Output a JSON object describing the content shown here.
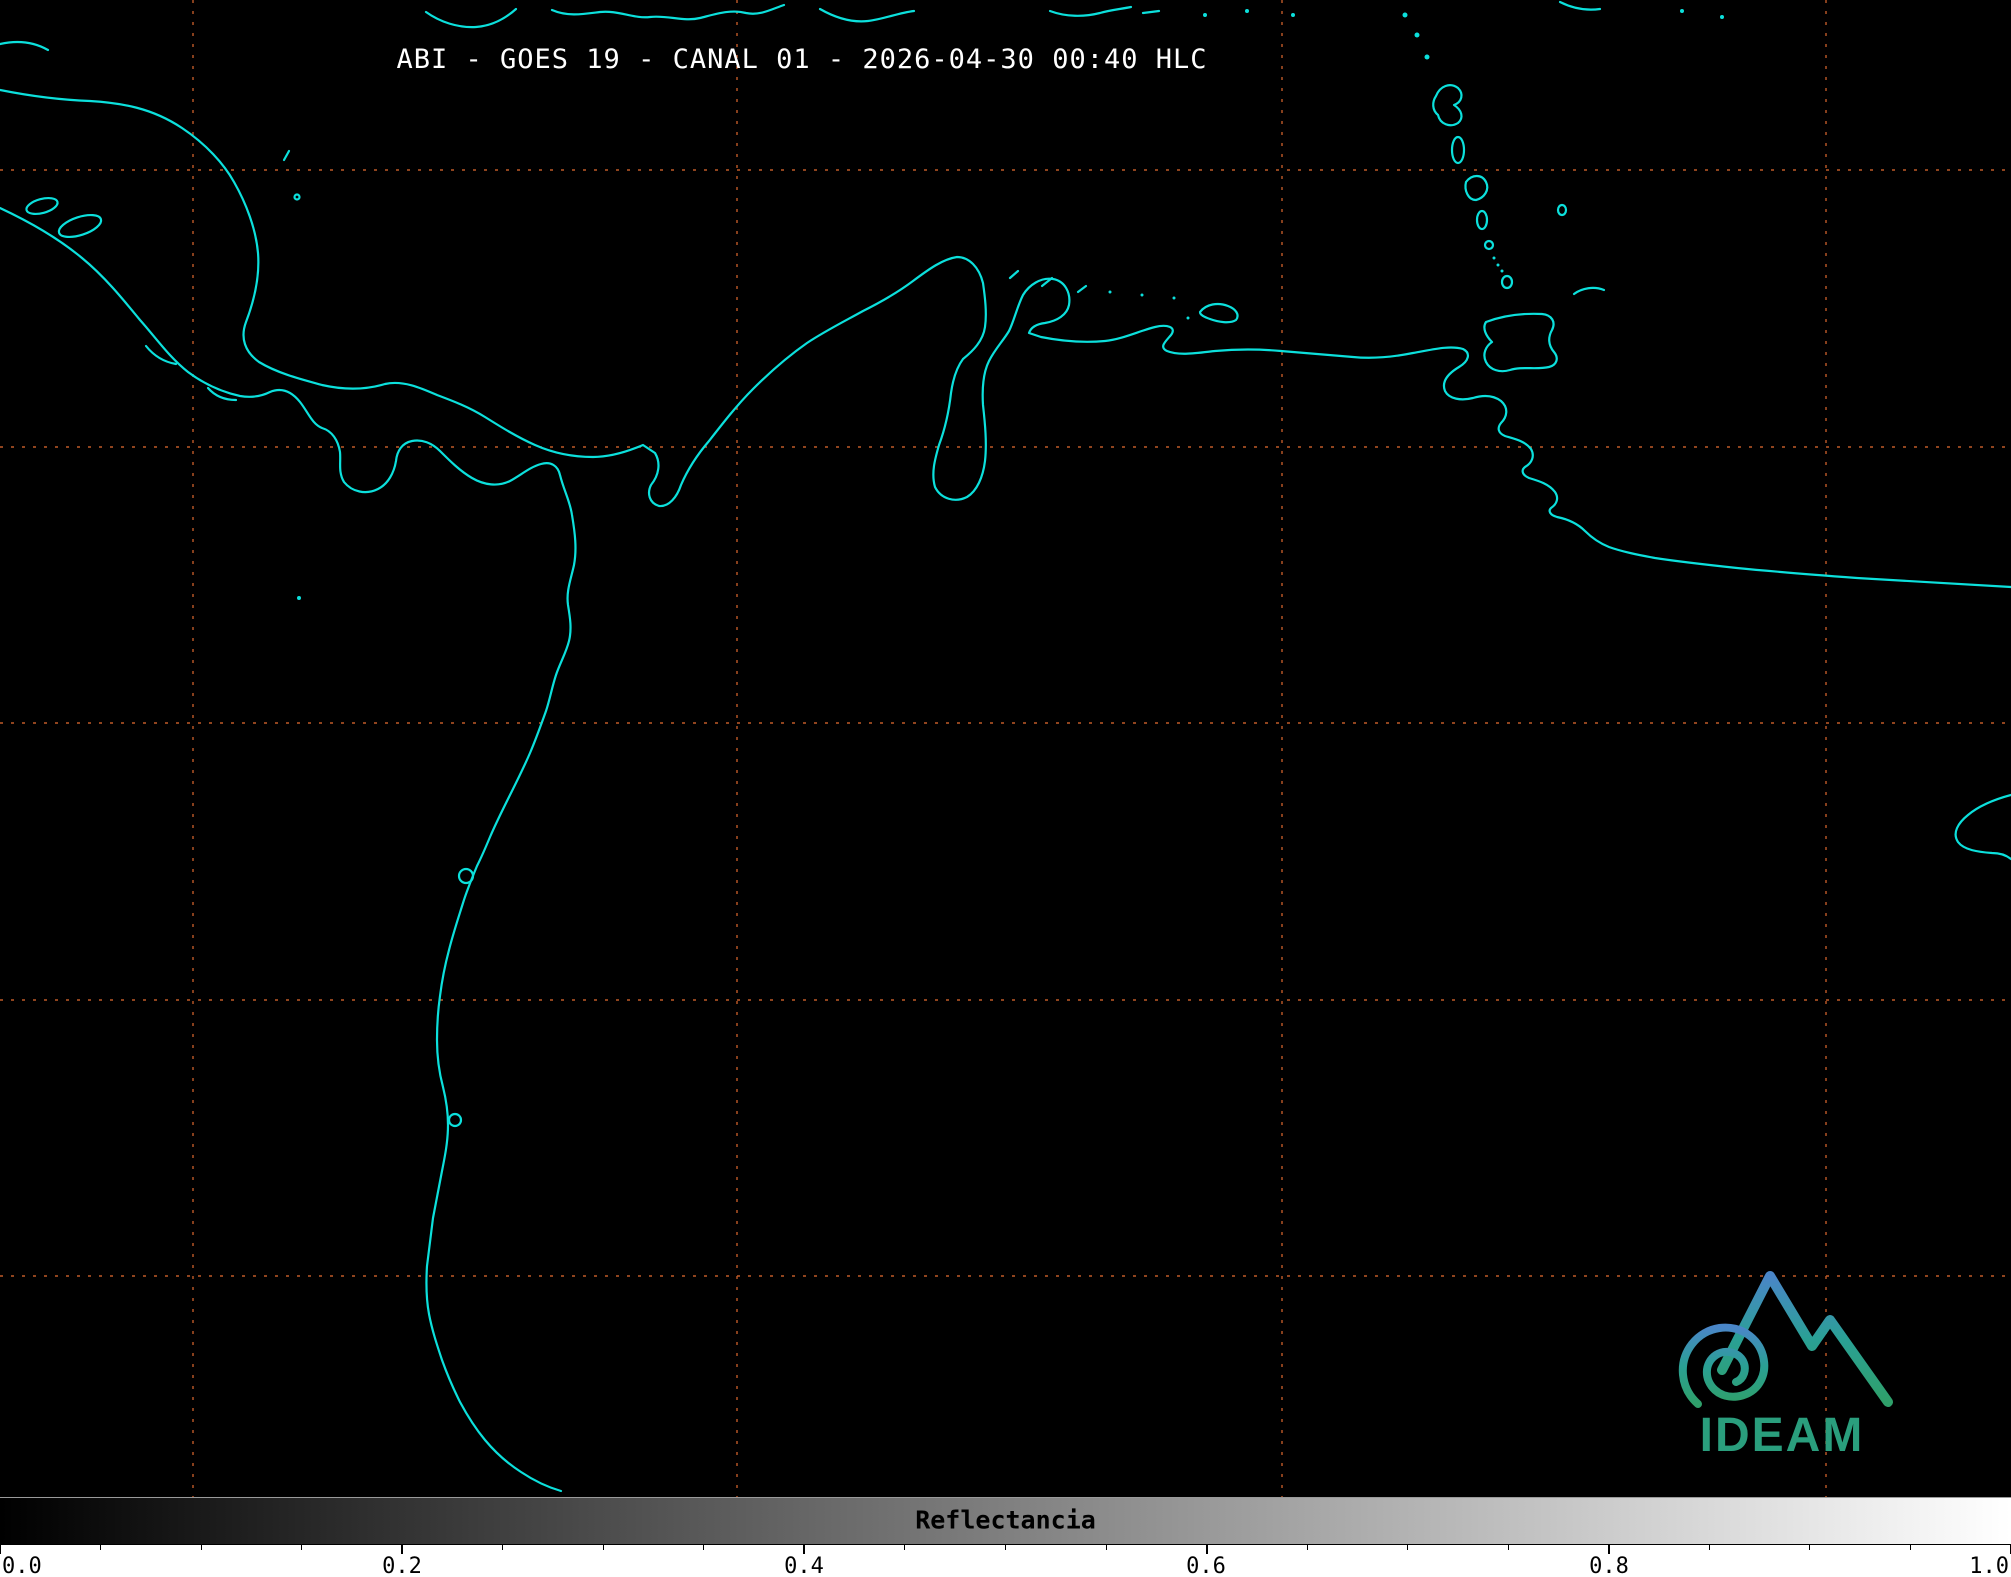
{
  "header": {
    "title": "ABI - GOES 19 - CANAL 01 - 2026-04-30 00:40 HLC"
  },
  "map": {
    "background_color": "#000000",
    "coastline_color": "#0ce0dc",
    "grid_color": "#c05a28"
  },
  "colorbar": {
    "label": "Reflectancia",
    "tick_labels": [
      "0.0",
      "0.2",
      "0.4",
      "0.6",
      "0.8",
      "1.0"
    ],
    "gradient_start": "#000000",
    "gradient_end": "#ffffff"
  },
  "logo": {
    "text": "IDEAM",
    "text_color": "#2a9e7d",
    "art_gradient_top": "#4a86c8",
    "art_gradient_middle": "#2aa095",
    "art_gradient_bottom": "#2fa06a"
  }
}
